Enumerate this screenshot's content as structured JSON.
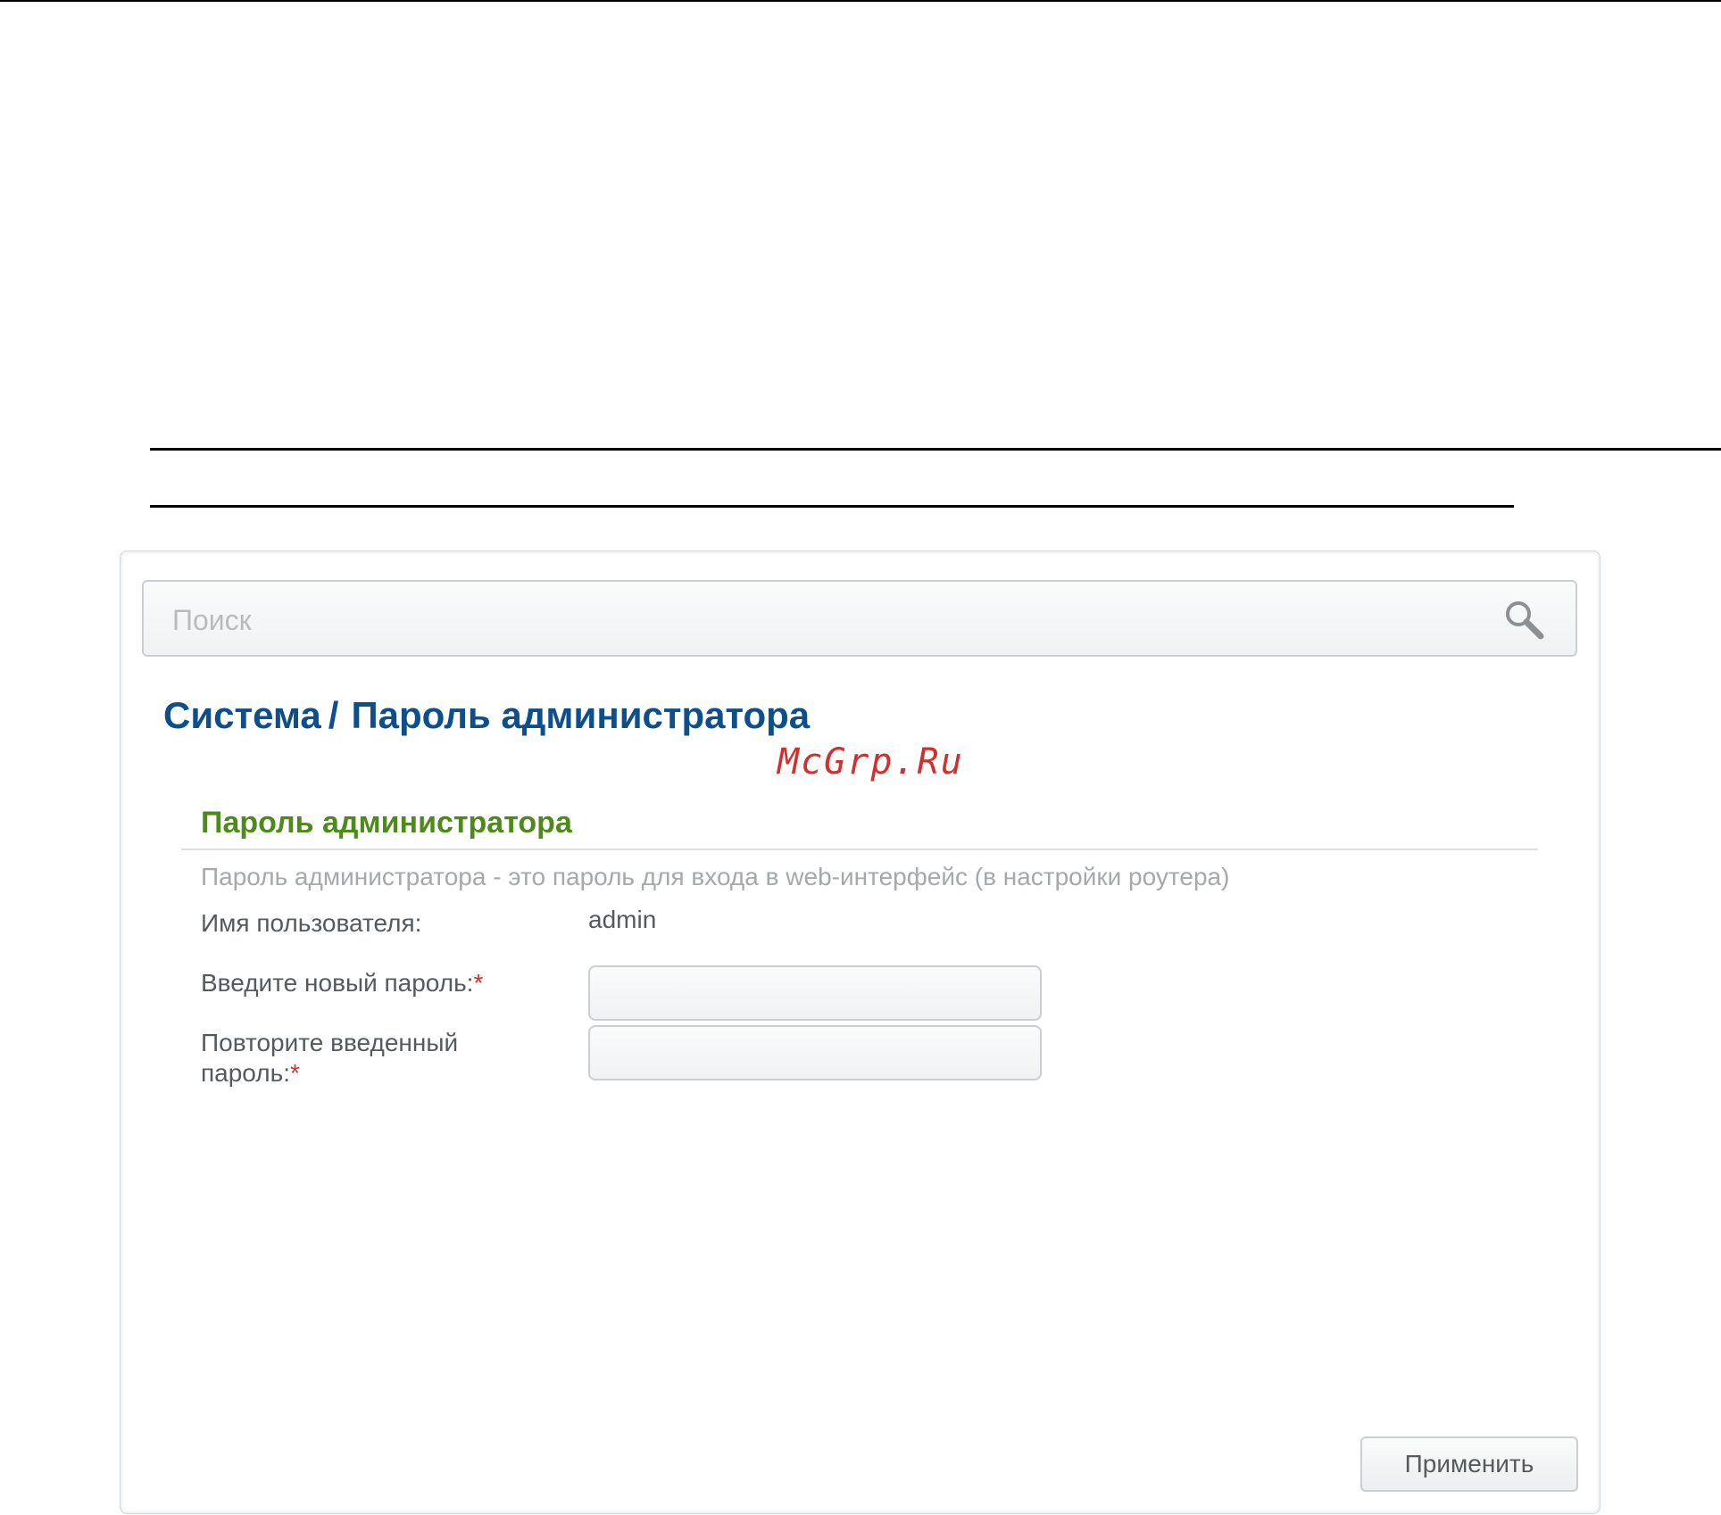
{
  "search": {
    "placeholder": "Поиск",
    "value": ""
  },
  "breadcrumb": {
    "section": "Система",
    "separator": "/",
    "page": "Пароль администратора"
  },
  "watermark": "McGrp.Ru",
  "admin_password": {
    "title": "Пароль администратора",
    "description": "Пароль администратора - это пароль для входа в web-интерфейс (в настройки роутера)",
    "username_label": "Имя пользователя:",
    "username_value": "admin",
    "new_password_label": "Введите новый пароль:",
    "repeat_password_label_line1": "Повторите введенный",
    "repeat_password_label_line2": "пароль:",
    "required_marker": "*",
    "new_password_value": "",
    "repeat_password_value": ""
  },
  "actions": {
    "apply_label": "Применить"
  },
  "colors": {
    "breadcrumb": "#0d4f8b",
    "section_title": "#4e8a1a",
    "required": "#d32f2f",
    "watermark": "#d32f2f"
  },
  "icons": {
    "search": "search-icon"
  }
}
